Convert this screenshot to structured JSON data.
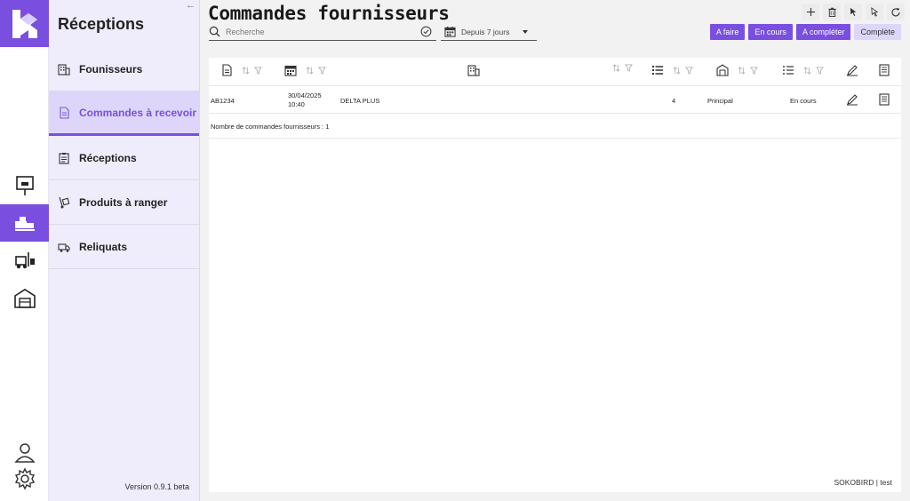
{
  "app": {
    "sidebar_title": "Réceptions",
    "collapse_icon": "arrow-left-icon",
    "version": "Version 0.9.1 beta",
    "accent": "#7a4fe0"
  },
  "sidebar": {
    "items": [
      {
        "label": "Founisseurs",
        "icon": "building-icon",
        "active": false
      },
      {
        "label": "Commandes à recevoir",
        "icon": "document-icon",
        "active": true
      },
      {
        "label": "Réceptions",
        "icon": "clipboard-list-icon",
        "active": false
      },
      {
        "label": "Produits à ranger",
        "icon": "hand-truck-icon",
        "active": false
      },
      {
        "label": "Reliquats",
        "icon": "truck-icon",
        "active": false
      }
    ]
  },
  "rail": {
    "items": [
      "package-sign-icon",
      "delivery-truck-icon",
      "forklift-icon",
      "warehouse-icon"
    ],
    "bottom": [
      "user-icon",
      "gear-icon"
    ]
  },
  "header": {
    "title": "Commandes fournisseurs",
    "search_placeholder": "Recherche",
    "date_filter": "Depuis 7 jours",
    "toolbar_icons": [
      "plus-icon",
      "trash-icon",
      "cursor-select-icon",
      "cursor-icon",
      "refresh-icon"
    ],
    "status_buttons": [
      {
        "label": "A faire",
        "active": true
      },
      {
        "label": "En cours",
        "active": true
      },
      {
        "label": "A compléter",
        "active": true
      },
      {
        "label": "Complète",
        "active": false
      }
    ]
  },
  "table": {
    "rows": [
      {
        "ref": "AB1234",
        "date": "30/04/2025",
        "time": "10:40",
        "supplier": "DELTA PLUS",
        "lines": "4",
        "warehouse": "Principal",
        "status": "En cours"
      }
    ],
    "count_text": "Nombre de commandes fournisseurs : 1"
  },
  "footer": {
    "user": "SOKOBIRD | test"
  }
}
